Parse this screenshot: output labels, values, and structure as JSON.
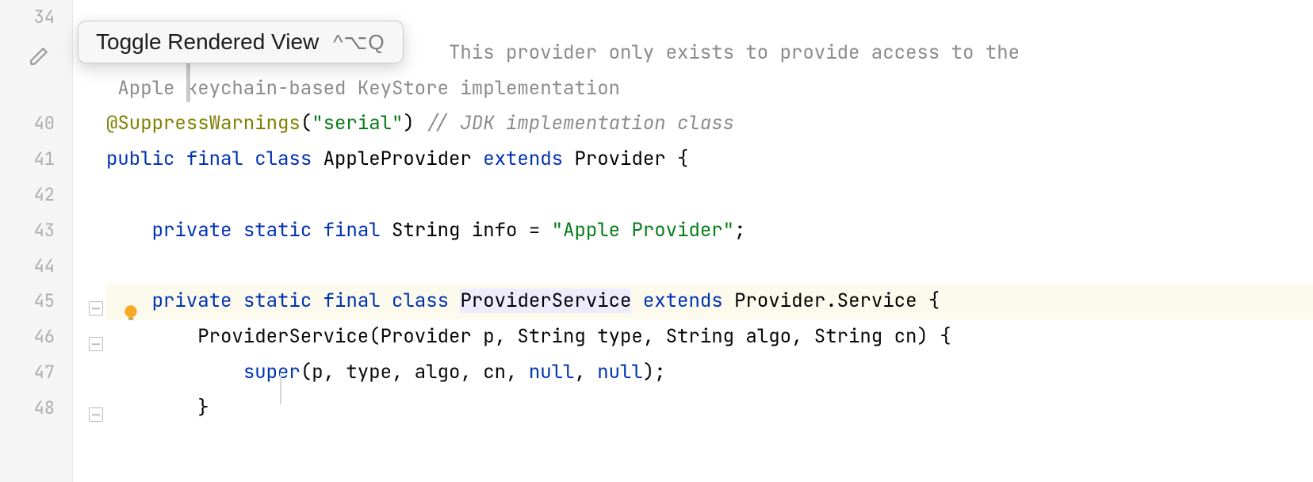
{
  "tooltip": {
    "label": "Toggle Rendered View",
    "shortcut": "^⌥Q"
  },
  "lines": {
    "l34": "34",
    "l40": "40",
    "l41": "41",
    "l42": "42",
    "l43": "43",
    "l44": "44",
    "l45": "45",
    "l46": "46",
    "l47": "47",
    "l48": "48"
  },
  "code": {
    "doc_line1_vis": "                              This provider only exists to provide access to the",
    "doc_line2": " Apple keychain-based KeyStore implementation",
    "anno": "@SuppressWarnings",
    "anno_paren_open": "(",
    "anno_str": "\"serial\"",
    "anno_paren_close": ")",
    "anno_comment": " // JDK implementation class",
    "k_public": "public",
    "k_final": "final",
    "k_class": "class",
    "cls_apple": "AppleProvider",
    "k_extends": "extends",
    "cls_provider": "Provider",
    "brace_open": " {",
    "k_private": "private",
    "k_static": "static",
    "type_string": "String",
    "id_info": "info",
    "eq": " = ",
    "str_apple_provider": "\"Apple Provider\"",
    "semi": ";",
    "cls_providerservice": "ProviderService",
    "cls_provider_service_qual": "Provider.Service",
    "ctor_sig_pre": "ProviderService(Provider p, String type, String algo, String cn) {",
    "k_super": "super",
    "super_args_pre": "(p, type, algo, cn, ",
    "k_null": "null",
    "comma_sp": ", ",
    "super_args_post": ");",
    "brace_close": "}"
  }
}
